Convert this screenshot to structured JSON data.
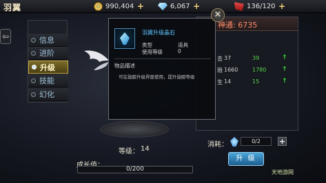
{
  "header": {
    "title": "羽翼",
    "gold": "990,404",
    "diamonds": "6,067",
    "energy": "136/120"
  },
  "tabs": [
    {
      "label": "信息",
      "active": false
    },
    {
      "label": "进阶",
      "active": false
    },
    {
      "label": "升级",
      "active": true
    },
    {
      "label": "技能",
      "active": false
    },
    {
      "label": "幻化",
      "active": false
    }
  ],
  "stats": {
    "power_label": "神通: 6735",
    "rows": [
      {
        "name": "击",
        "current": "37",
        "next": "39"
      },
      {
        "name": "限",
        "current": "1660",
        "next": "1780"
      },
      {
        "name": "生",
        "current": "14",
        "next": "15"
      }
    ]
  },
  "wing": {
    "level_label": "等级：",
    "level_value": "14",
    "growth_label": "成长值：",
    "growth_text": "0/200",
    "growth_progress": 0
  },
  "consume": {
    "label": "消耗：",
    "count": "0/2"
  },
  "upgrade_button": "升 级",
  "tooltip": {
    "item_name": "羽翼升级晶石",
    "type_label": "类型",
    "type_value": "道具",
    "level_label": "使用等级",
    "level_value": "0",
    "desc_title": "物品描述",
    "desc_text": "可在翅膀升级界面使用，提升翅膀等级"
  },
  "watermark": "天地游网",
  "colors": {
    "accent": "#5fc6ff",
    "power": "#ff8b6a",
    "positive": "#54d44c"
  }
}
